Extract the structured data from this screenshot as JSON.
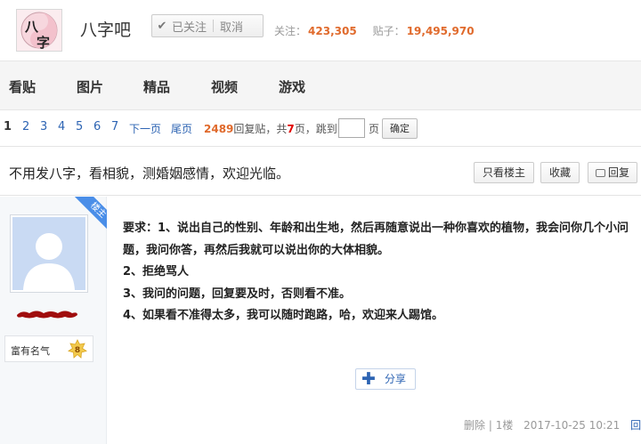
{
  "forum": {
    "name": "八字吧",
    "logo_char": "八字",
    "follow_label": "已关注",
    "unfollow_label": "取消",
    "followers_label": "关注：",
    "followers": "423,305",
    "posts_label": "贴子：",
    "posts": "19,495,970"
  },
  "nav": {
    "items": [
      "看贴",
      "图片",
      "精品",
      "视频",
      "游戏"
    ]
  },
  "pager": {
    "current": "1",
    "pages": [
      "2",
      "3",
      "4",
      "5",
      "6",
      "7"
    ],
    "next_label": "下一页",
    "last_label": "尾页",
    "reply_count": "2489",
    "reply_text": "回复贴，共",
    "page_count": "7",
    "page_suffix": "页，跳到",
    "page_unit": "页",
    "jump_value": "",
    "confirm_label": "确定"
  },
  "thread": {
    "title": "不用发八字，看相貌，测婚姻感情，欢迎光临。",
    "only_author_label": "只看楼主",
    "favorite_label": "收藏",
    "reply_label": "回复"
  },
  "post": {
    "badge": "楼主",
    "level_name": "富有名气",
    "level_num": "8",
    "content": [
      "要求：1、说出自己的性别、年龄和出生地，然后再随意说出一种你喜欢的植物，我会问你几个小问题，我问你答，再然后我就可以说出你的大体相貌。",
      "2、拒绝骂人",
      "3、我问的问题，回复要及时，否则看不准。",
      "4、如果看不准得太多，我可以随时跑路，哈，欢迎来人踢馆。"
    ],
    "share_label": "分享",
    "delete_label": "删除",
    "floor": "1楼",
    "time": "2017-10-25 10:21",
    "reply_label": "回复"
  },
  "colors": {
    "accent_orange": "#e06a2c",
    "link_blue": "#2d64b3",
    "badge_blue": "#4a8ee8"
  }
}
